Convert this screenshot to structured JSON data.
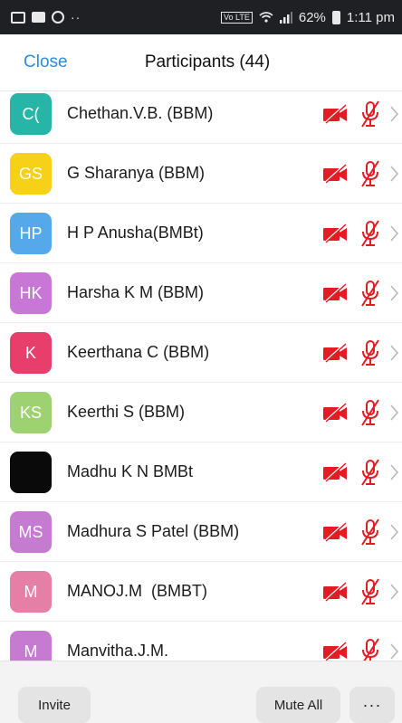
{
  "status_bar": {
    "dots": "··",
    "volte": "Vo LTE",
    "battery_percent": "62%",
    "time": "1:11 pm",
    "left_icons": [
      "image-icon",
      "message-icon",
      "whatsapp-icon"
    ],
    "right_icons": [
      "volte-icon",
      "wifi-icon",
      "signal-icon",
      "battery-icon"
    ]
  },
  "header": {
    "close_label": "Close",
    "title": "Participants (44)"
  },
  "colors": {
    "accent": "#2d8cdb",
    "muted_icon": "#e31b23"
  },
  "participants": [
    {
      "initials": "C(",
      "name": "Chethan.V.B. (BBM)",
      "avatar_color": "#26b5a7"
    },
    {
      "initials": "GS",
      "name": "G Sharanya (BBM)",
      "avatar_color": "#f7d117"
    },
    {
      "initials": "HP",
      "name": "H P Anusha(BMBt)",
      "avatar_color": "#55a9ea"
    },
    {
      "initials": "HK",
      "name": "Harsha K M (BBM)",
      "avatar_color": "#c877d6"
    },
    {
      "initials": "K",
      "name": "Keerthana C (BBM)",
      "avatar_color": "#e83e6b"
    },
    {
      "initials": "KS",
      "name": "Keerthi S (BBM)",
      "avatar_color": "#9ed16f"
    },
    {
      "initials": "",
      "name": "Madhu K N BMBt",
      "avatar_color": "#0a0a0a"
    },
    {
      "initials": "MS",
      "name": "Madhura S Patel (BBM)",
      "avatar_color": "#c47bd0"
    },
    {
      "initials": "M",
      "name": "MANOJ.M  (BMBT)",
      "avatar_color": "#e57fa5"
    },
    {
      "initials": "M",
      "name": "Manvitha.J.M.",
      "avatar_color": "#c47bd0"
    }
  ],
  "bottom_bar": {
    "invite_label": "Invite",
    "mute_all_label": "Mute All",
    "more_label": "···"
  }
}
